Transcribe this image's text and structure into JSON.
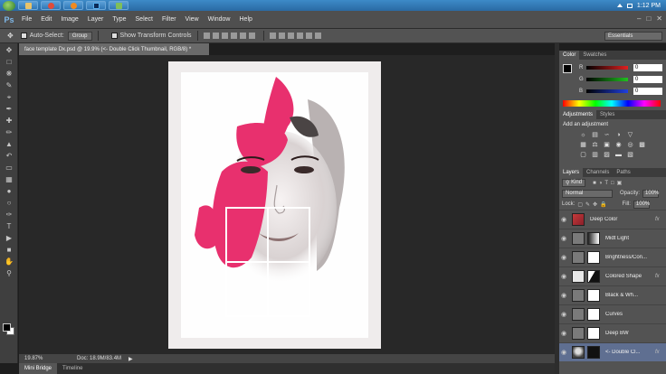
{
  "taskbar": {
    "clock": "1:12 PM"
  },
  "app": {
    "logo": "Ps"
  },
  "menu": [
    "File",
    "Edit",
    "Image",
    "Layer",
    "Type",
    "Select",
    "Filter",
    "View",
    "Window",
    "Help"
  ],
  "options_bar": {
    "auto_select_label": "Auto-Select:",
    "auto_select_value": "Group",
    "show_transform_label": "Show Transform Controls",
    "workspace": "Essentials"
  },
  "document": {
    "tab_title": "face template Dx.psd @ 19.9% (<- Double Click Thumbnail, RGB/8) *",
    "zoom": "19.87%",
    "doc_size": "Doc: 18.9M/83.4M"
  },
  "bottom_tabs": [
    "Mini Bridge",
    "Timeline"
  ],
  "color_panel": {
    "tabs": [
      "Color",
      "Swatches"
    ],
    "channels": [
      {
        "label": "R",
        "value": "0",
        "color": "#e02020"
      },
      {
        "label": "G",
        "value": "0",
        "color": "#20c020"
      },
      {
        "label": "B",
        "value": "0",
        "color": "#2040e0"
      }
    ]
  },
  "adjustments_panel": {
    "tabs": [
      "Adjustments",
      "Styles"
    ],
    "title": "Add an adjustment"
  },
  "layers_panel": {
    "tabs": [
      "Layers",
      "Channels",
      "Paths"
    ],
    "kind_label": "Kind",
    "blend_mode": "Normal",
    "opacity_label": "Opacity:",
    "opacity_value": "100%",
    "lock_label": "Lock:",
    "fill_label": "Fill:",
    "fill_value": "100%",
    "layers": [
      {
        "name": "Deep Color",
        "fx": "fx"
      },
      {
        "name": "Midt Light",
        "fx": ""
      },
      {
        "name": "Brightness/Con...",
        "fx": ""
      },
      {
        "name": "Colored Shape",
        "fx": "fx"
      },
      {
        "name": "Black & Wh...",
        "fx": ""
      },
      {
        "name": "Curves",
        "fx": ""
      },
      {
        "name": "Deep BW",
        "fx": ""
      },
      {
        "name": "<- Double Cl...",
        "fx": "fx"
      }
    ]
  },
  "colors": {
    "accent_pink": "#e8306e",
    "selected_layer": "#5f6f91"
  }
}
